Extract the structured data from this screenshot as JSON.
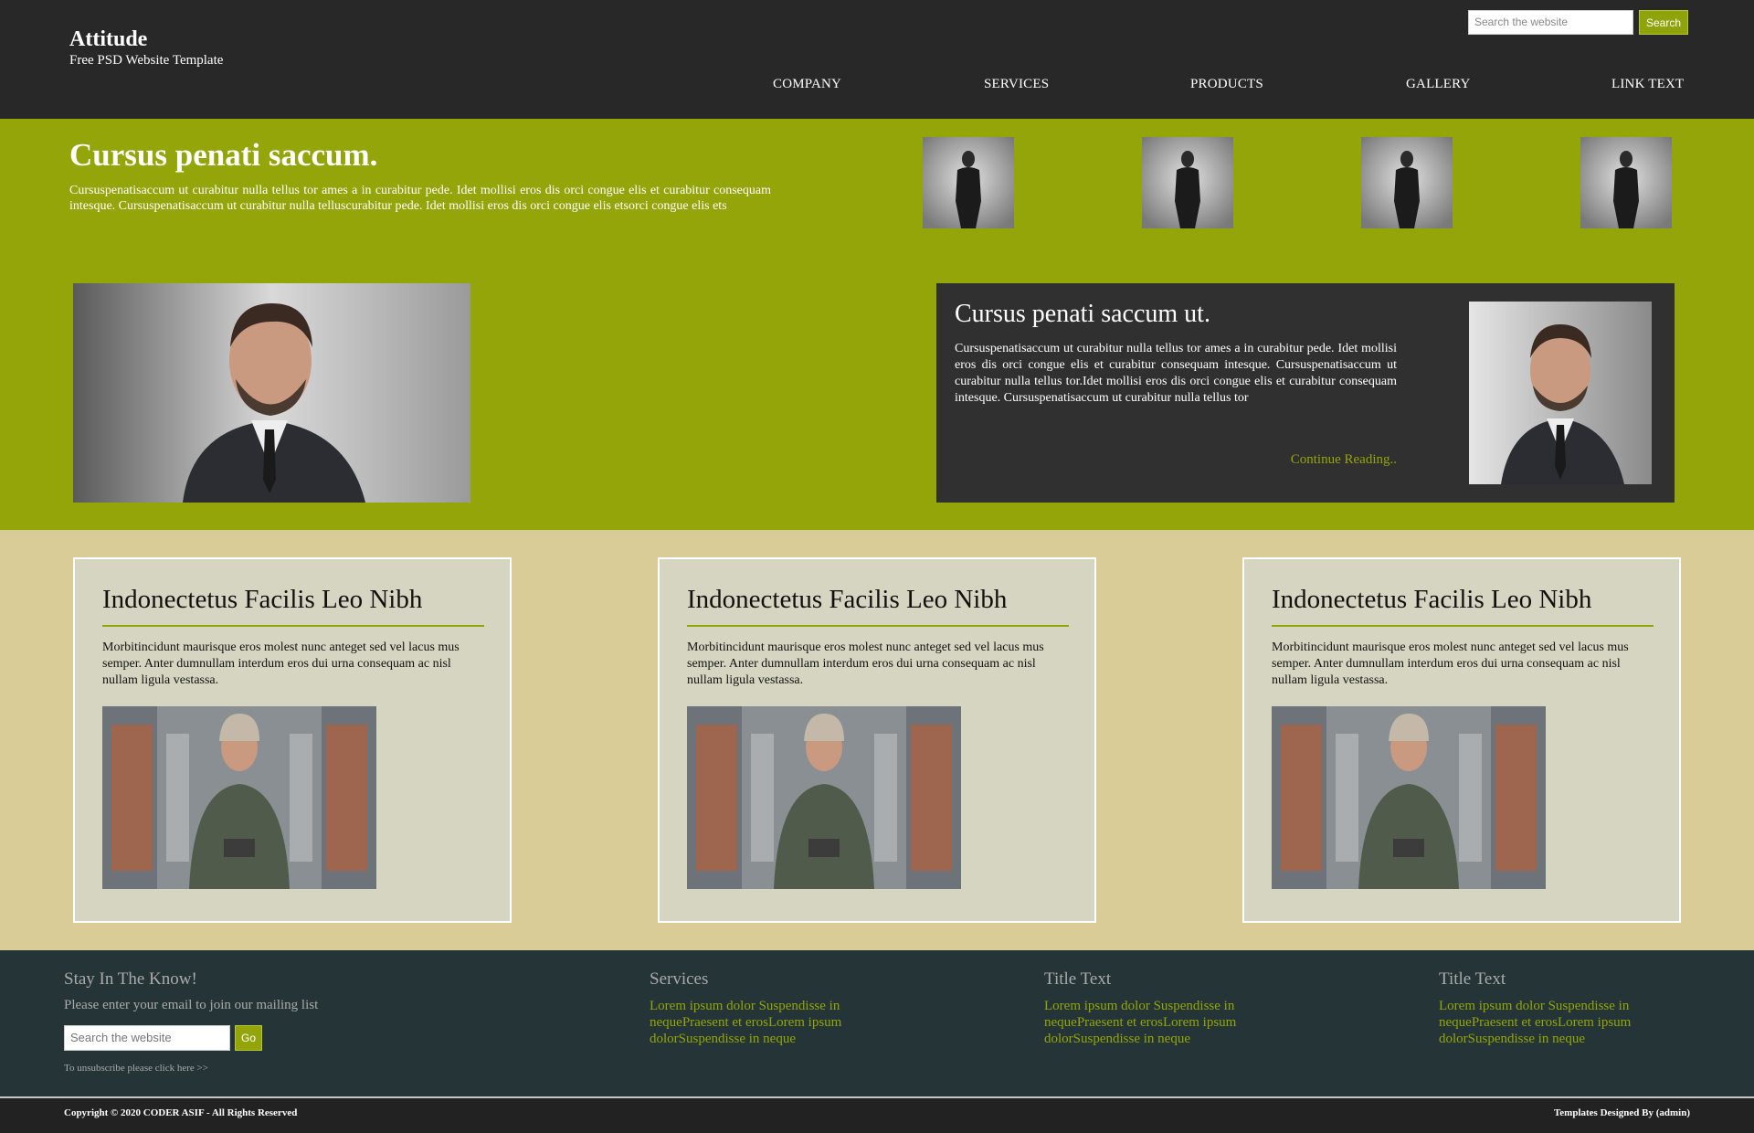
{
  "header": {
    "title": "Attitude",
    "subtitle": "Free PSD Website Template",
    "search_placeholder": "Search the website",
    "search_button": "Search",
    "nav": [
      "COMPANY",
      "SERVICES",
      "PRODUCTS",
      "GALLERY",
      "LINK TEXT"
    ]
  },
  "hero": {
    "title": "Cursus penati saccum.",
    "text": "Cursuspenatisaccum ut curabitur nulla tellus tor ames a in curabitur pede. Idet mollisi eros dis orci congue elis et curabitur consequam intesque. Cursuspenatisaccum ut curabitur nulla telluscurabitur pede. Idet mollisi eros dis orci congue elis etsorci congue elis ets"
  },
  "feature": {
    "title": "Cursus penati saccum ut.",
    "text": "Cursuspenatisaccum ut curabitur nulla tellus tor ames a in curabitur pede. Idet mollisi eros dis orci congue elis et curabitur consequam intesque. Cursuspenatisaccum ut curabitur nulla tellus tor.Idet mollisi eros dis orci congue elis et curabitur consequam intesque. Cursuspenatisaccum ut curabitur nulla tellus tor",
    "link": "Continue Reading.."
  },
  "cards": [
    {
      "title": "Indonectetus Facilis Leo Nibh",
      "text": "Morbitincidunt maurisque eros molest nunc anteget sed vel lacus mus semper. Anter dumnullam interdum eros dui urna consequam ac nisl nullam ligula vestassa."
    },
    {
      "title": "Indonectetus Facilis Leo Nibh",
      "text": "Morbitincidunt maurisque eros molest nunc anteget sed vel lacus mus semper. Anter dumnullam interdum eros dui urna consequam ac nisl nullam ligula vestassa."
    },
    {
      "title": "Indonectetus Facilis Leo Nibh",
      "text": "Morbitincidunt maurisque eros molest nunc anteget sed vel lacus mus semper. Anter dumnullam interdum eros dui urna consequam ac nisl nullam ligula vestassa."
    }
  ],
  "footer": {
    "newsletter_title": "Stay In The Know!",
    "newsletter_text": "Please enter your email to join our mailing list",
    "newsletter_placeholder": "Search the website",
    "newsletter_button": "Go",
    "unsubscribe": "To unsubscribe please click here >>",
    "columns": [
      {
        "title": "Services",
        "text": "Lorem ipsum dolor Suspendisse in nequePraesent et erosLorem ipsum dolorSuspendisse in neque"
      },
      {
        "title": "Title Text",
        "text": "Lorem ipsum dolor Suspendisse in nequePraesent et erosLorem ipsum dolorSuspendisse in neque"
      },
      {
        "title": "Title Text",
        "text": "Lorem ipsum dolor Suspendisse in nequePraesent et erosLorem ipsum dolorSuspendisse in neque"
      }
    ],
    "copyright": "Copyright © 2020 CODER ASIF - All Rights Reserved",
    "credits": "Templates Designed By (admin)"
  },
  "colors": {
    "header_bg": "#282828",
    "accent": "#93a508",
    "cards_bg": "#d9cc97",
    "card_bg": "#d5d5c1",
    "footer_bg": "#253436",
    "feature_bg": "#303030"
  }
}
